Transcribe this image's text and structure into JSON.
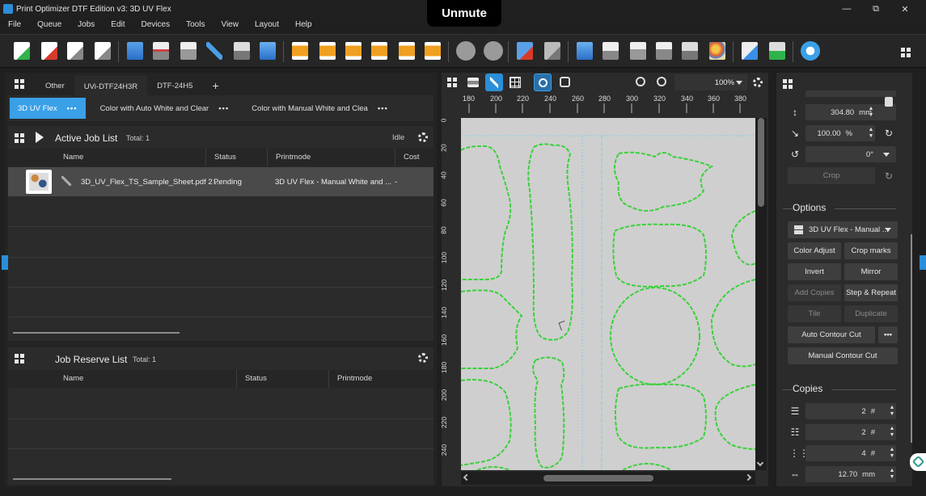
{
  "window": {
    "title": "Print Optimizer DTF Edition v3: 3D UV Flex",
    "minimize": "—",
    "maximize": "⧉",
    "close": "✕"
  },
  "overlay": {
    "unmute_label": "Unmute"
  },
  "menu": [
    "File",
    "Queue",
    "Jobs",
    "Edit",
    "Devices",
    "Tools",
    "View",
    "Layout",
    "Help"
  ],
  "printer_tabs": {
    "tabs": [
      "Other",
      "UVi-DTF24H3R",
      "DTF-24H5"
    ],
    "add_label": "+"
  },
  "preset_tabs": [
    {
      "label": "3D UV Flex",
      "menu": "•••"
    },
    {
      "label": "Color with Auto White and Clear",
      "menu": "•••"
    },
    {
      "label": "Color with Manual White and Clea",
      "menu": "•••"
    }
  ],
  "active_jobs": {
    "title": "Active Job List",
    "total": "Total: 1",
    "status": "Idle",
    "columns": [
      "Name",
      "Status",
      "Printmode",
      "Cost"
    ],
    "rows": [
      {
        "name": "3D_UV_Flex_TS_Sample_Sheet.pdf 2 ...",
        "status": "Pending",
        "printmode": "3D UV Flex - Manual White and ...",
        "cost": "-"
      }
    ]
  },
  "reserve_jobs": {
    "title": "Job Reserve List",
    "total": "Total: 1",
    "columns": [
      "Name",
      "Status",
      "Printmode"
    ]
  },
  "canvas": {
    "zoom": "100%",
    "ruler_top": [
      "180",
      "200",
      "220",
      "240",
      "260",
      "280",
      "300",
      "320",
      "340",
      "360",
      "380"
    ],
    "ruler_left": [
      "0",
      "20",
      "40",
      "60",
      "80",
      "100",
      "120",
      "140",
      "160",
      "180",
      "200",
      "220",
      "240"
    ]
  },
  "properties": {
    "height_value": "304.80",
    "height_unit": "mm",
    "scale_value": "100.00",
    "scale_unit": "%",
    "rotation_value": "0°",
    "crop_label": "Crop",
    "options_title": "Options",
    "printmode_select": "3D UV Flex - Manual ...",
    "buttons": {
      "color_adjust": "Color Adjust",
      "crop_marks": "Crop marks",
      "invert": "Invert",
      "mirror": "Mirror",
      "add_copies": "Add Copies",
      "step_repeat": "Step & Repeat",
      "tile": "Tile",
      "duplicate": "Duplicate",
      "auto_contour": "Auto Contour Cut",
      "auto_contour_more": "•••",
      "manual_contour": "Manual Contour Cut"
    },
    "copies_title": "Copies",
    "rows_value": "2",
    "cols_value": "2",
    "total_value": "4",
    "count_unit": "#",
    "spacing_value": "12.70",
    "spacing_unit": "mm"
  },
  "colors": {
    "accent": "#3aa0e8",
    "contour": "#3ad13a",
    "artboard": "#cfcfcf"
  }
}
